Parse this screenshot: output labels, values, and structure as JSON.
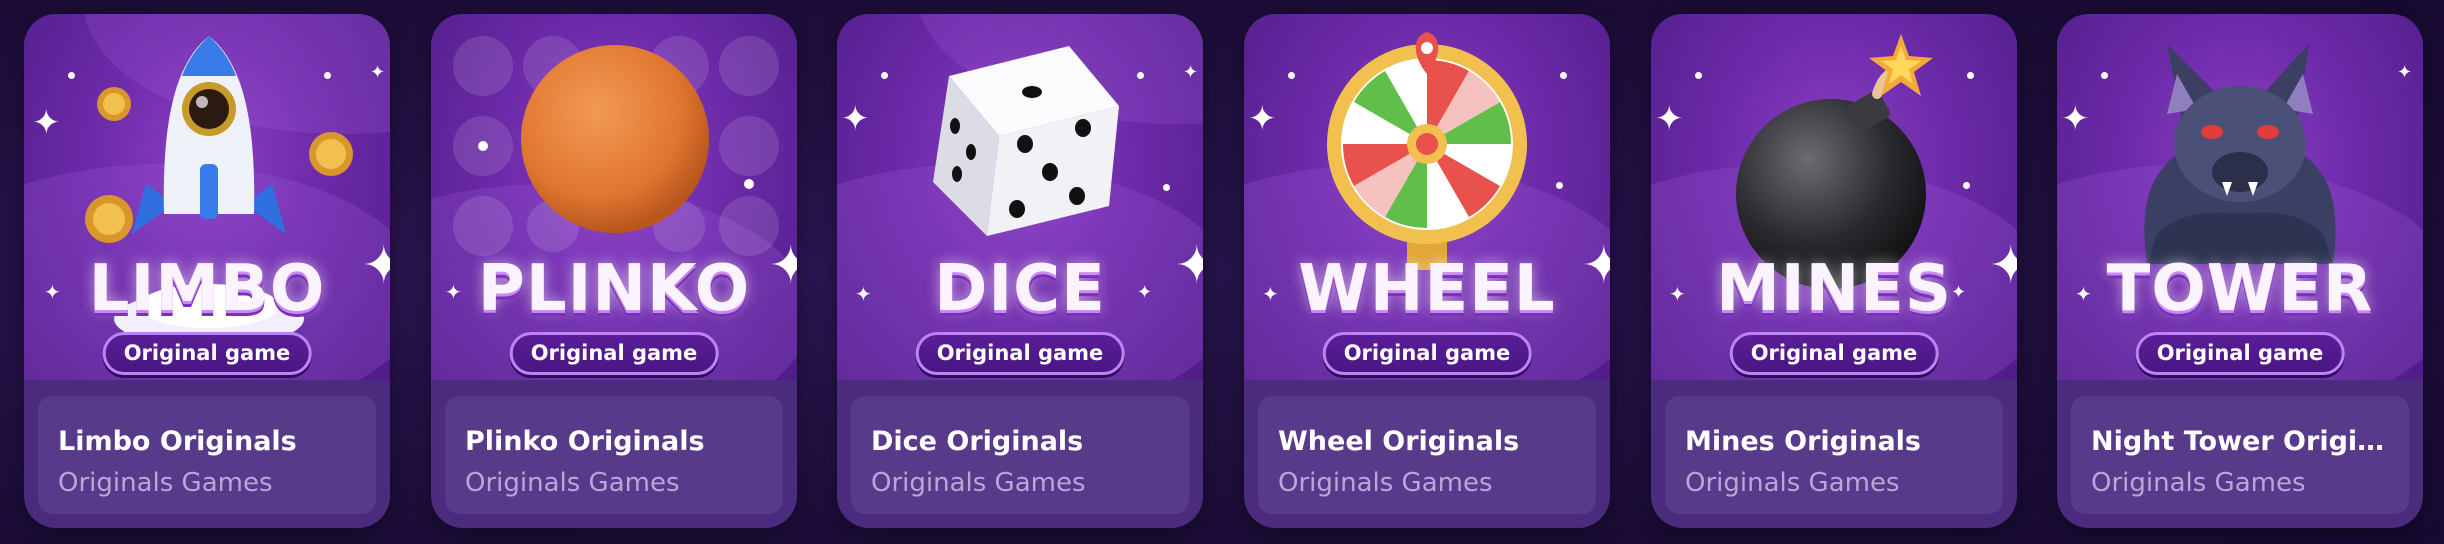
{
  "cards": [
    {
      "big_title": "LIMBO",
      "badge": "Original game",
      "title": "Limbo Originals",
      "subtitle": "Originals Games",
      "icon": "rocket-icon"
    },
    {
      "big_title": "PLINKO",
      "badge": "Original game",
      "title": "Plinko Originals",
      "subtitle": "Originals Games",
      "icon": "ball-icon"
    },
    {
      "big_title": "DICE",
      "badge": "Original game",
      "title": "Dice Originals",
      "subtitle": "Originals Games",
      "icon": "dice-icon"
    },
    {
      "big_title": "WHEEL",
      "badge": "Original game",
      "title": "Wheel Originals",
      "subtitle": "Originals Games",
      "icon": "fortune-wheel-icon"
    },
    {
      "big_title": "MINES",
      "badge": "Original game",
      "title": "Mines Originals",
      "subtitle": "Originals Games",
      "icon": "bomb-icon"
    },
    {
      "big_title": "TOWER",
      "badge": "Original game",
      "title": "Night Tower Originals",
      "subtitle": "Originals Games",
      "icon": "werewolf-icon"
    }
  ],
  "colors": {
    "page_background": "#1e0f3d",
    "card_art": "#6c2aa8",
    "info_panel": "#583a8a",
    "subtitle_text": "#b9a6d9"
  }
}
